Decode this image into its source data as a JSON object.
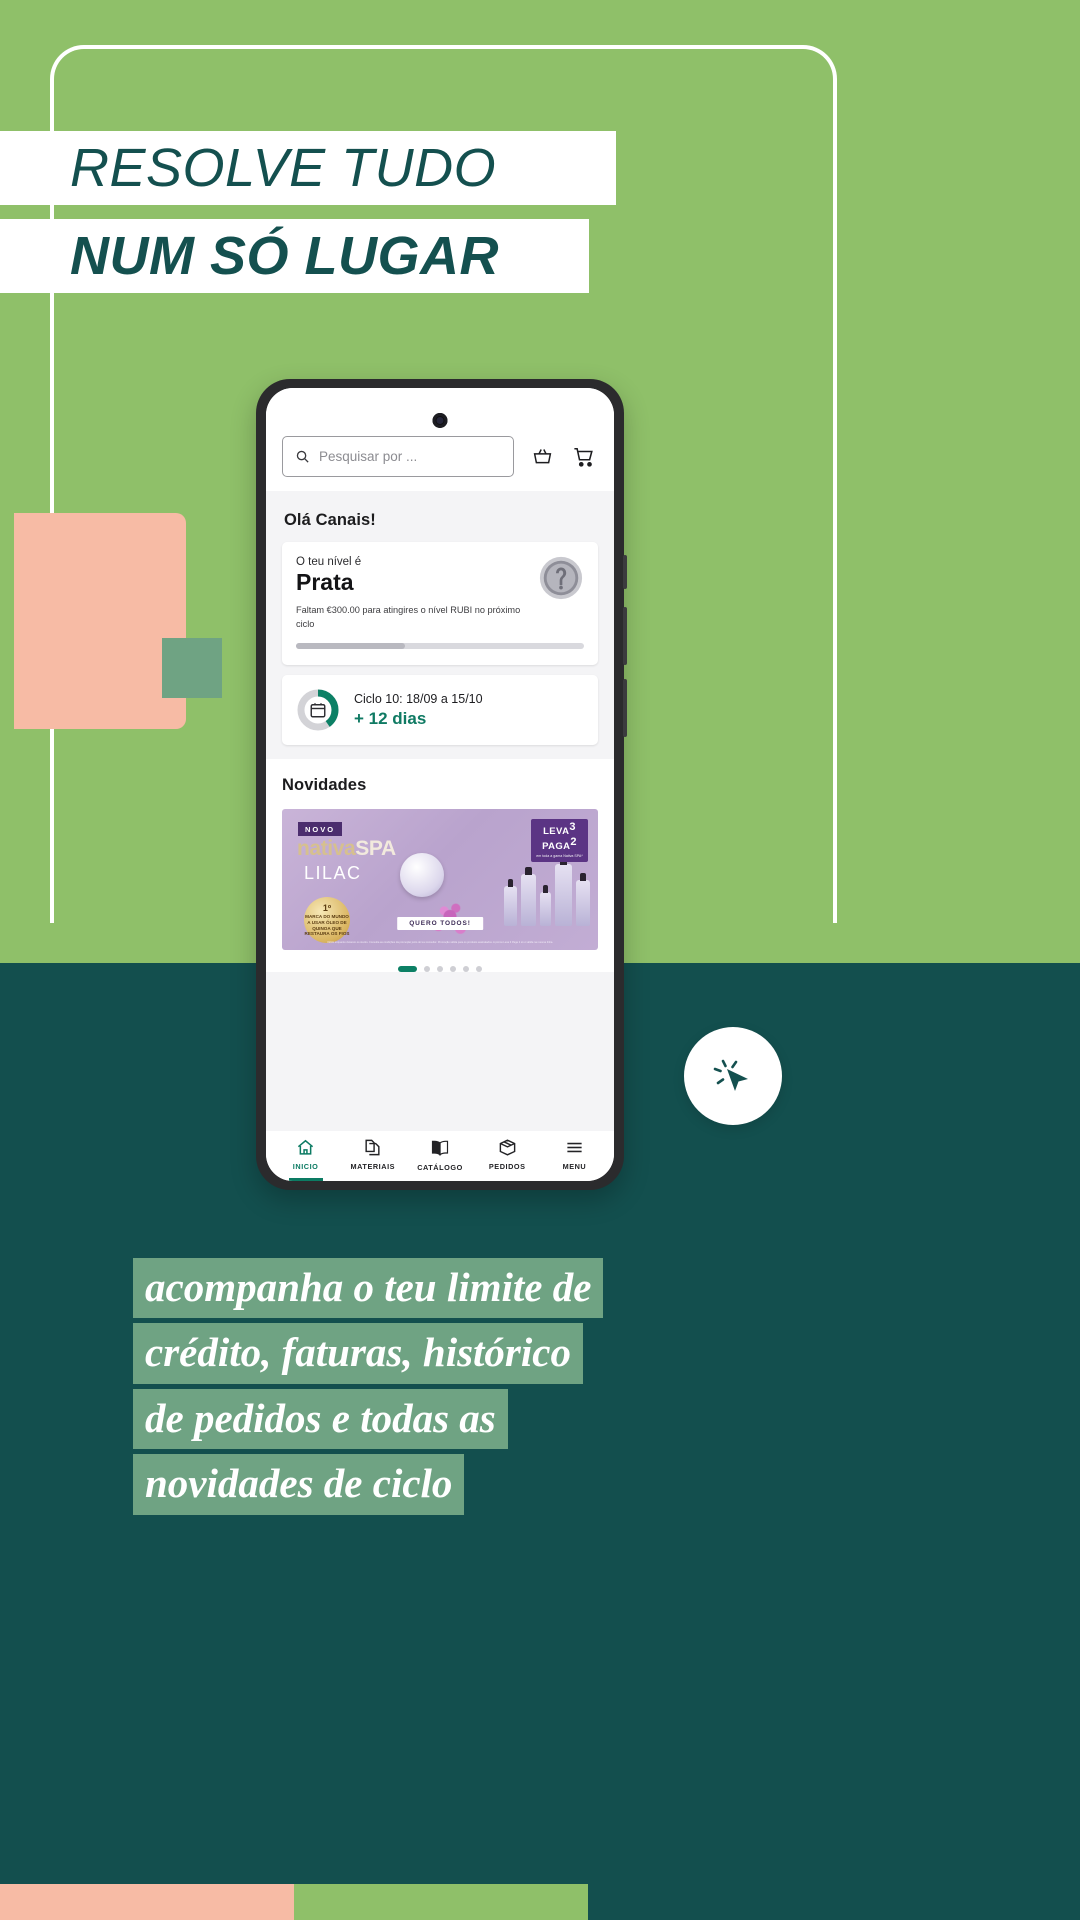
{
  "poster": {
    "headline_line1": "RESOLVE TUDO",
    "headline_line2": "NUM SÓ LUGAR",
    "paragraph_lines": [
      "acompanha o teu limite de",
      "crédito, faturas, histórico",
      "de pedidos e todas as",
      "novidades de ciclo"
    ],
    "colors": {
      "green": "#8FC069",
      "teal": "#134F4E",
      "peach": "#F7BBA5",
      "sage": "#6FA383",
      "accent_teal": "#0C7B63"
    }
  },
  "app": {
    "search": {
      "placeholder": "Pesquisar por ...",
      "icon": "search-icon"
    },
    "actions": [
      {
        "icon": "basket-icon",
        "name": "basket-button"
      },
      {
        "icon": "cart-icon",
        "name": "cart-button"
      }
    ],
    "greeting": "Olá Canais!",
    "level_card": {
      "label": "O teu nível é",
      "value": "Prata",
      "note": "Faltam €300.00 para atingires o nível RUBI no próximo ciclo",
      "medal_icon": "silver-medal-icon",
      "progress_percent": 38
    },
    "cycle_card": {
      "title": "Ciclo 10: 18/09 a 15/10",
      "days": "+ 12 dias",
      "icon": "calendar-icon",
      "ring_percent": 40
    },
    "news": {
      "title": "Novidades",
      "promo": {
        "tag": "NOVO",
        "brand_a": "nativa",
        "brand_b": "SPA",
        "variant": "LILAC",
        "seal_number": "1º",
        "seal_text": "MARCA DO MUNDO A USAR ÓLEO DE QUINOA QUE RESTAURA OS FIOS",
        "offer_line1": "LEVA",
        "offer_num1": "3",
        "offer_line2": "PAGA",
        "offer_num2": "2",
        "offer_note": "em toda a gama Nativa SPA*",
        "cta": "QUERO TODOS!",
        "legal": "Válido enquanto durarem os stocks. Consulta as condições da promoção junto do teu consultor. Promoção válida para os produtos assinalados. A promo Leva 3 Paga 2 só é válida na mesma linha."
      },
      "carousel_dots": 6,
      "carousel_active": 1
    },
    "tabs": [
      {
        "label": "INICIO",
        "icon": "home-icon",
        "active": true
      },
      {
        "label": "MATERIAIS",
        "icon": "documents-icon",
        "active": false
      },
      {
        "label": "CATÁLOGO",
        "icon": "book-icon",
        "active": false
      },
      {
        "label": "PEDIDOS",
        "icon": "box-icon",
        "active": false
      },
      {
        "label": "MENU",
        "icon": "hamburger-icon",
        "active": false
      }
    ]
  },
  "cursor_badge": {
    "icon": "click-cursor-icon"
  }
}
